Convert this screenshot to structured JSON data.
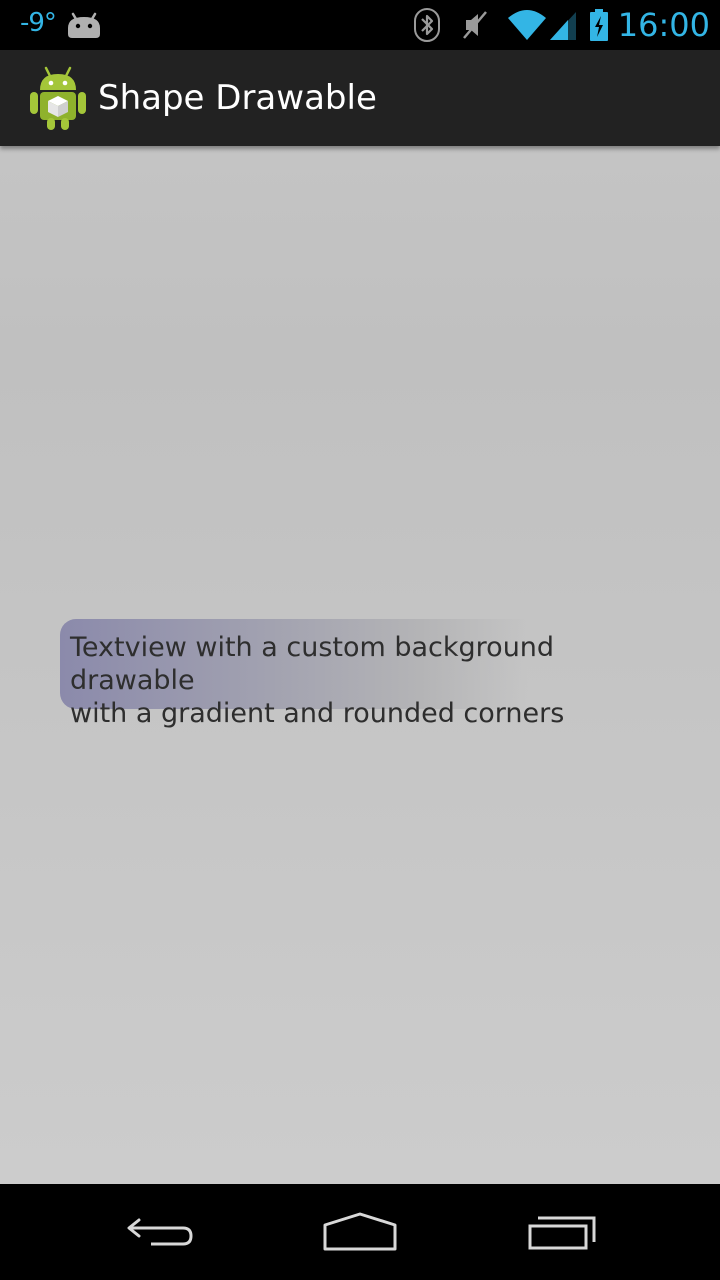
{
  "status_bar": {
    "temperature": "-9°",
    "time": "16:00",
    "icons": [
      "android-notification-icon",
      "bluetooth-icon",
      "muted-icon",
      "wifi-icon",
      "signal-icon",
      "battery-charging-icon"
    ]
  },
  "action_bar": {
    "title": "Shape Drawable",
    "app_icon": "android-app-icon"
  },
  "content": {
    "textview_text": "Textview with a custom background drawable\nwith a gradient and rounded corners",
    "gradient_colors": [
      "#8b8aab",
      "#c4c4c4"
    ]
  },
  "nav_bar": {
    "buttons": [
      "back-icon",
      "home-icon",
      "recent-apps-icon"
    ]
  },
  "colors": {
    "status_accent": "#33b5e5",
    "action_bar_bg": "#222222",
    "content_bg": "#c4c4c4"
  }
}
